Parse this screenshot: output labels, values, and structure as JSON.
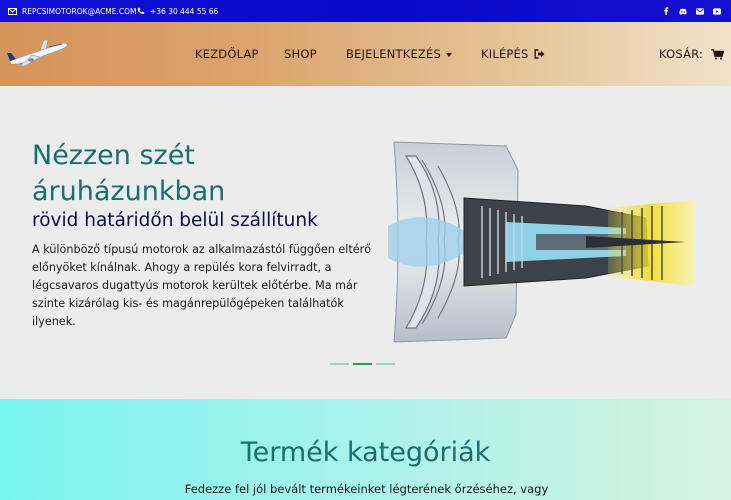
{
  "topbar": {
    "email": "REPCSIMOTOROK@ACME.COM",
    "phone": "+36 30 444 55 66",
    "social": [
      "facebook-icon",
      "discord-icon",
      "email-icon",
      "youtube-icon"
    ]
  },
  "nav": {
    "home": "KEZDŐLAP",
    "shop": "SHOP",
    "login": "BEJELENTKEZÉS",
    "logout": "KILÉPÉS",
    "cart": "KOSÁR:"
  },
  "hero": {
    "title": "Nézzen szét áruházunkban",
    "subtitle": "rövid határidőn belül szállítunk",
    "text": "A különböző típusú motorok az alkalmazástól függően eltérő előnyöket kínálnak. Ahogy a repülés kora felvirradt, a légcsavaros dugattyús motorok kerültek előtérbe. Ma már szinte kizárólag kis- és magánrepülőgépeken találhatók ilyenek.",
    "slides": 3,
    "active_slide": 2
  },
  "categories": {
    "title": "Termék kategóriák",
    "text": "Fedezze fel jól bevált termékeinket légterének őrzéséhez, vagy"
  },
  "colors": {
    "topbar": "#0a08c8",
    "accent": "#17706e",
    "subtitle": "#0c0c48"
  }
}
